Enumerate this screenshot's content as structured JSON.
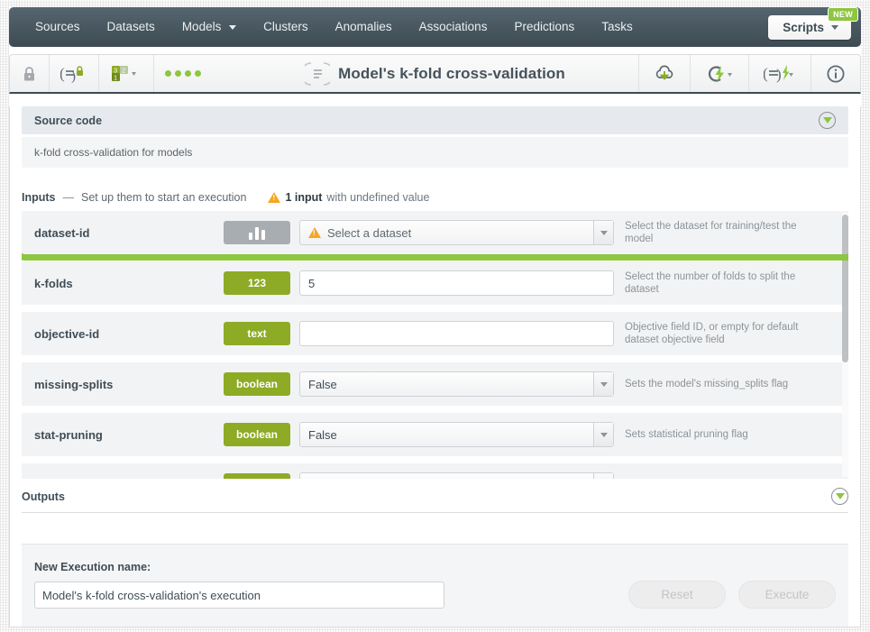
{
  "nav": {
    "items": [
      {
        "label": "Sources",
        "caret": false
      },
      {
        "label": "Datasets",
        "caret": false
      },
      {
        "label": "Models",
        "caret": true
      },
      {
        "label": "Clusters",
        "caret": false
      },
      {
        "label": "Anomalies",
        "caret": false
      },
      {
        "label": "Associations",
        "caret": false
      },
      {
        "label": "Predictions",
        "caret": false
      },
      {
        "label": "Tasks",
        "caret": false
      }
    ],
    "scripts_label": "Scripts",
    "new_badge": "NEW"
  },
  "toolbar": {
    "lock_icon": "lock-icon",
    "script_icon": "script-privacy-icon",
    "version_icon": "script-version-icon",
    "status_dots": 4,
    "title": "Model's k-fold cross-validation",
    "title_icon": "script-icon",
    "download_icon": "cloud-download-icon",
    "execute_icon": "lightning-execute-icon",
    "new_execution_icon": "script-execute-icon",
    "info_icon": "info-icon"
  },
  "source_section": {
    "title": "Source code",
    "description": "k-fold cross-validation for models",
    "expander_icon": "chevron-down-circle-icon"
  },
  "inputs_section": {
    "title": "Inputs",
    "dash": "—",
    "subtitle": "Set up them to start an execution",
    "warning_count": "1 input",
    "warning_suffix": "with undefined value",
    "warning_icon": "warning-triangle-icon",
    "rows": [
      {
        "name": "dataset-id",
        "type_label": "",
        "type_icon": "bar-chart-icon",
        "type_style": "gray",
        "control": "select",
        "value": "Select a dataset",
        "value_is_placeholder": true,
        "has_warning": true,
        "hint": "Select the dataset for training/test the model",
        "highlighted": true
      },
      {
        "name": "k-folds",
        "type_label": "123",
        "type_style": "green",
        "control": "text",
        "value": "5",
        "value_is_placeholder": false,
        "has_warning": false,
        "hint": "Select the number of folds to split the dataset",
        "highlighted": false
      },
      {
        "name": "objective-id",
        "type_label": "text",
        "type_style": "green",
        "control": "text",
        "value": "",
        "value_is_placeholder": false,
        "has_warning": false,
        "hint": "Objective field ID, or empty for default dataset objective field",
        "highlighted": false
      },
      {
        "name": "missing-splits",
        "type_label": "boolean",
        "type_style": "green",
        "control": "select",
        "value": "False",
        "value_is_placeholder": false,
        "has_warning": false,
        "hint": "Sets the model's missing_splits flag",
        "highlighted": false
      },
      {
        "name": "stat-pruning",
        "type_label": "boolean",
        "type_style": "green",
        "control": "select",
        "value": "False",
        "value_is_placeholder": false,
        "has_warning": false,
        "hint": "Sets statistical pruning flag",
        "highlighted": false
      }
    ]
  },
  "outputs_section": {
    "title": "Outputs",
    "expander_icon": "chevron-down-circle-icon"
  },
  "footer": {
    "execution_name_label": "New Execution name:",
    "execution_name_value": "Model's k-fold cross-validation's execution",
    "reset_label": "Reset",
    "execute_label": "Execute"
  },
  "colors": {
    "nav_dark": "#4a5962",
    "accent_green": "#8dc63f",
    "badge_green": "#8dab25",
    "badge_gray": "#a8adb1",
    "warning_orange": "#f5a623",
    "text_dark": "#3f4d57",
    "text_muted": "#8b949a"
  }
}
